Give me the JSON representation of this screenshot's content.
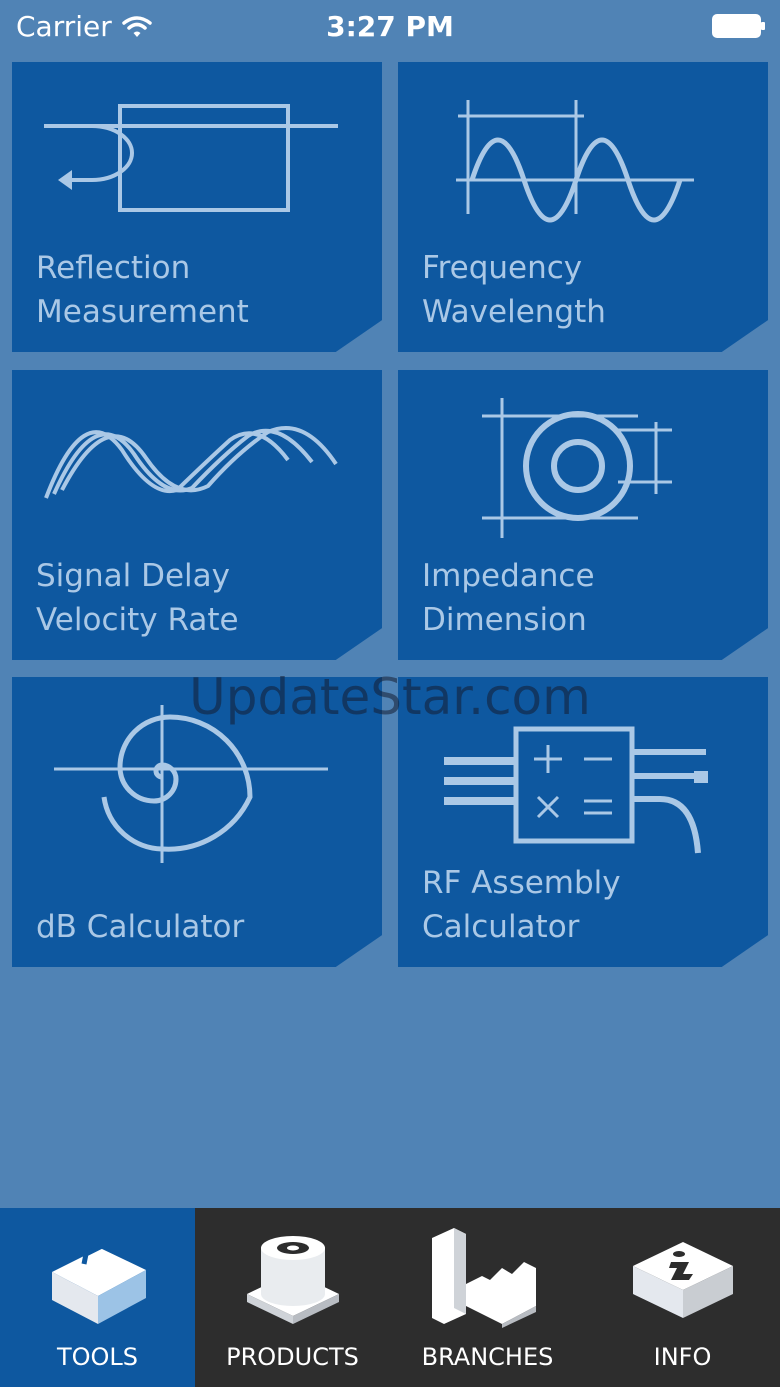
{
  "status_bar": {
    "carrier": "Carrier",
    "time": "3:27 PM"
  },
  "tiles": [
    {
      "line1": "Reflection",
      "line2": "Measurement",
      "icon": "reflection-icon"
    },
    {
      "line1": "Frequency",
      "line2": "Wavelength",
      "icon": "sine-wave-icon"
    },
    {
      "line1": "Signal Delay",
      "line2": "Velocity Rate",
      "icon": "delay-waves-icon"
    },
    {
      "line1": "Impedance",
      "line2": "Dimension",
      "icon": "coax-cross-section-icon"
    },
    {
      "line1": "",
      "line2": "dB Calculator",
      "icon": "spiral-icon"
    },
    {
      "line1": "RF Assembly",
      "line2": "Calculator",
      "icon": "calculator-box-icon"
    }
  ],
  "watermark": "UpdateStar.com",
  "tab_bar": {
    "tabs": [
      {
        "label": "TOOLS",
        "icon": "toolbox-icon",
        "active": true
      },
      {
        "label": "PRODUCTS",
        "icon": "connector-icon",
        "active": false
      },
      {
        "label": "BRANCHES",
        "icon": "factory-icon",
        "active": false
      },
      {
        "label": "INFO",
        "icon": "info-block-icon",
        "active": false
      }
    ]
  },
  "colors": {
    "background": "#5083b5",
    "tile": "#0e58a0",
    "tile_text": "#aac8e6",
    "tab_bar": "#2d2d2d",
    "tab_active": "#0e58a0"
  }
}
